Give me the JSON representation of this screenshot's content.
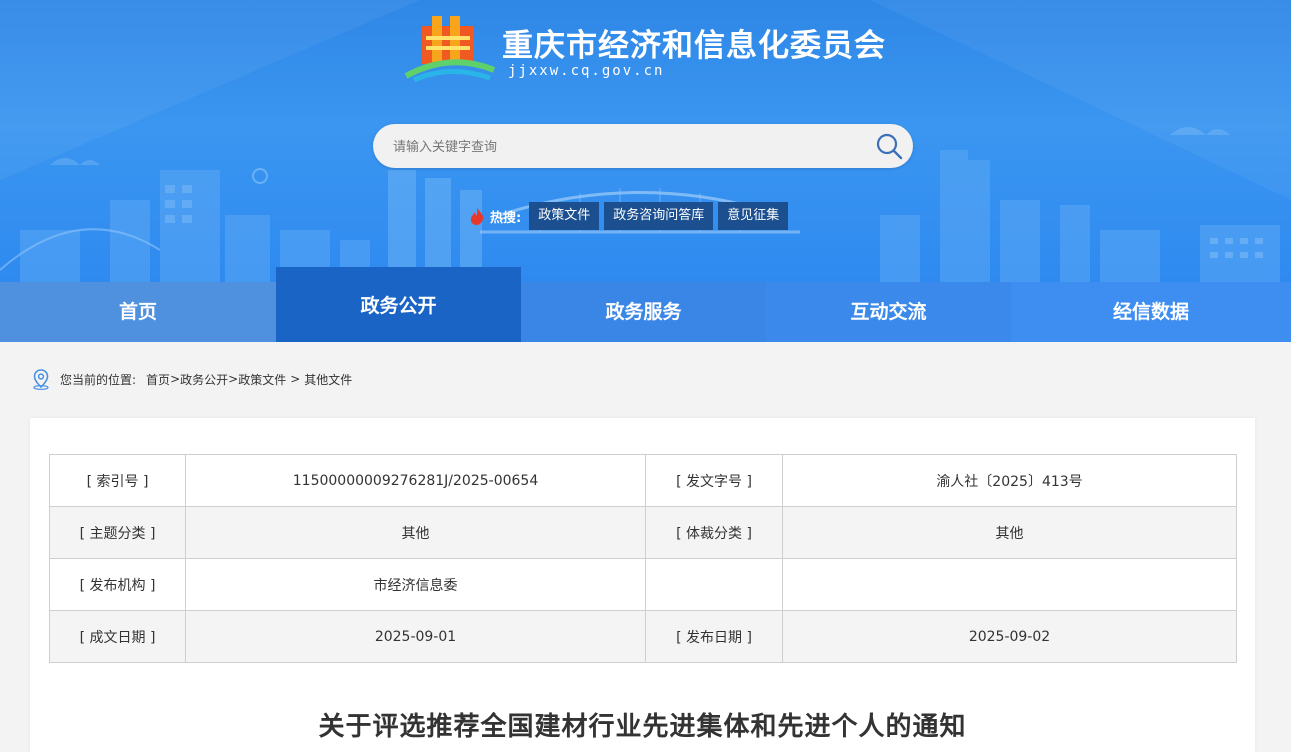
{
  "site": {
    "title": "重庆市经济和信息化委员会",
    "domain": "jjxxw.cq.gov.cn"
  },
  "search": {
    "placeholder": "请输入关键字查询"
  },
  "hot": {
    "label": "热搜:",
    "tags": [
      "政策文件",
      "政务咨询问答库",
      "意见征集"
    ]
  },
  "nav": {
    "items": [
      "首页",
      "政务公开",
      "政务服务",
      "互动交流",
      "经信数据"
    ],
    "active": "政务公开"
  },
  "breadcrumb": {
    "prefix": "您当前的位置:",
    "links": [
      "首页",
      "政务公开",
      "政策文件"
    ],
    "separator": ">",
    "current": "其他文件"
  },
  "meta": {
    "rows": [
      {
        "k1": "[ 索引号 ]",
        "v1": "11500000009276281J/2025-00654",
        "k2": "[ 发文字号 ]",
        "v2": "渝人社〔2025〕413号"
      },
      {
        "k1": "[ 主题分类 ]",
        "v1": "其他",
        "k2": "[ 体裁分类 ]",
        "v2": "其他"
      },
      {
        "k1": "[ 发布机构 ]",
        "v1": "市经济信息委",
        "k2": "",
        "v2": ""
      },
      {
        "k1": "[ 成文日期 ]",
        "v1": "2025-09-01",
        "k2": "[ 发布日期 ]",
        "v2": "2025-09-02"
      }
    ]
  },
  "document": {
    "title": "关于评选推荐全国建材行业先进集体和先进个人的通知"
  },
  "colors": {
    "header_blue": "#3a96f0",
    "nav_active": "#1a64c6",
    "hot_tag_bg": "#1b4f8f"
  }
}
